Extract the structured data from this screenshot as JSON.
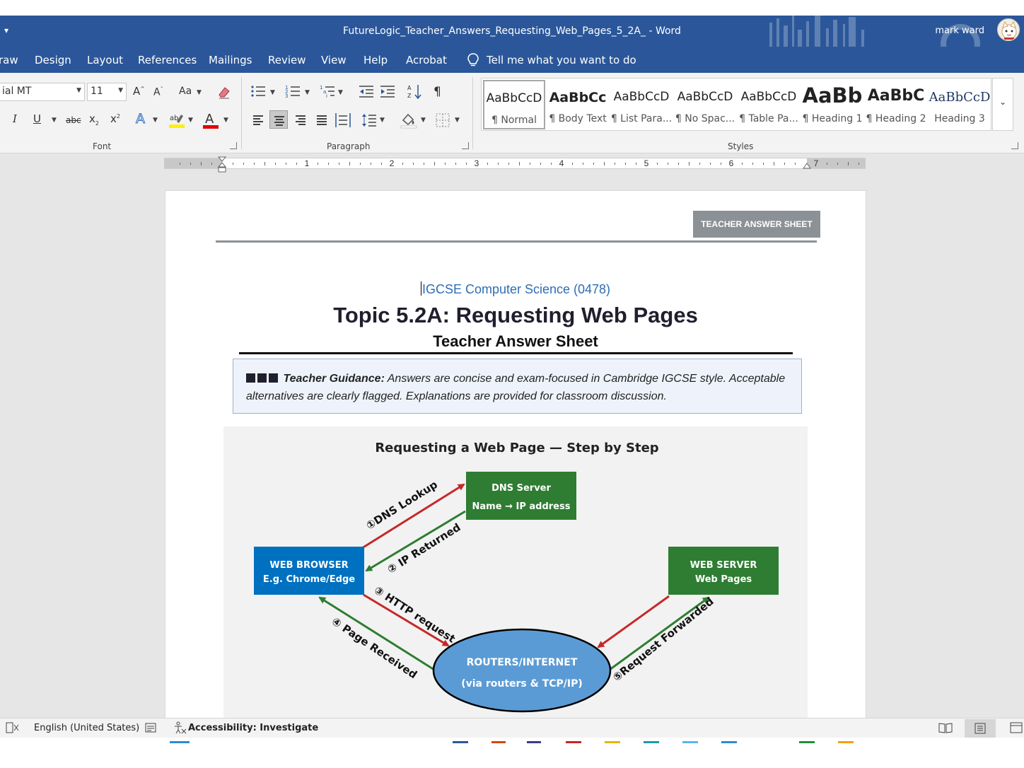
{
  "window": {
    "doc_title": "FutureLogic_Teacher_Answers_Requesting_Web_Pages_5_2A_  -  Word",
    "user": "mark ward"
  },
  "tabs": [
    "raw",
    "Design",
    "Layout",
    "References",
    "Mailings",
    "Review",
    "View",
    "Help",
    "Acrobat"
  ],
  "tell_me": "Tell me what you want to do",
  "ribbon": {
    "font_name": "ial MT",
    "font_size": "11",
    "font_group_label": "Font",
    "paragraph_group_label": "Paragraph",
    "styles_group_label": "Styles",
    "styles": [
      {
        "sample": "AaBbCcD",
        "name": "¶ Normal"
      },
      {
        "sample": "AaBbCc",
        "name": "¶ Body Text"
      },
      {
        "sample": "AaBbCcD",
        "name": "¶ List Para..."
      },
      {
        "sample": "AaBbCcD",
        "name": "¶ No Spac..."
      },
      {
        "sample": "AaBbCcD",
        "name": "¶ Table Pa..."
      },
      {
        "sample": "AaBb",
        "name": "¶ Heading 1"
      },
      {
        "sample": "AaBbC",
        "name": "¶ Heading 2"
      },
      {
        "sample": "AaBbCcD",
        "name": "Heading 3"
      }
    ],
    "accent_color": "#2b579a"
  },
  "ruler": {
    "numbers": [
      "1",
      "2",
      "3",
      "4",
      "5",
      "6",
      "7"
    ]
  },
  "document": {
    "badge": "TEACHER ANSWER SHEET",
    "course": "IGCSE Computer Science (0478)",
    "title": "Topic 5.2A: Requesting Web Pages",
    "subtitle": "Teacher Answer Sheet",
    "guidance_lead": "Teacher Guidance:",
    "guidance_text": " Answers are concise and exam-focused in Cambridge IGCSE style. Acceptable alternatives are clearly flagged. Explanations are provided for classroom discussion."
  },
  "diagram": {
    "title": "Requesting a Web Page — Step by Step",
    "dns_line1": "DNS Server",
    "dns_line2": "Name →  IP address",
    "browser_line1": "WEB BROWSER",
    "browser_line2": "E.g. Chrome/Edge",
    "server_line1": "WEB SERVER",
    "server_line2": "Web Pages",
    "routers_line1": "ROUTERS/INTERNET",
    "routers_line2": "(via routers & TCP/IP)",
    "step1": "①DNS Lookup",
    "step2": "② IP Returned",
    "step3": "③ HTTP request",
    "step4": "④ Page Received",
    "step5": "⑤Request Forwarded",
    "colors": {
      "browser": "#0070c0",
      "dns": "#2e7d32",
      "server": "#2e7d32",
      "routers": "#5b9bd5",
      "red_arrow": "#c62828",
      "green_arrow": "#2e7d32"
    }
  },
  "status": {
    "language": "English (United States)",
    "accessibility": "Accessibility: Investigate"
  }
}
